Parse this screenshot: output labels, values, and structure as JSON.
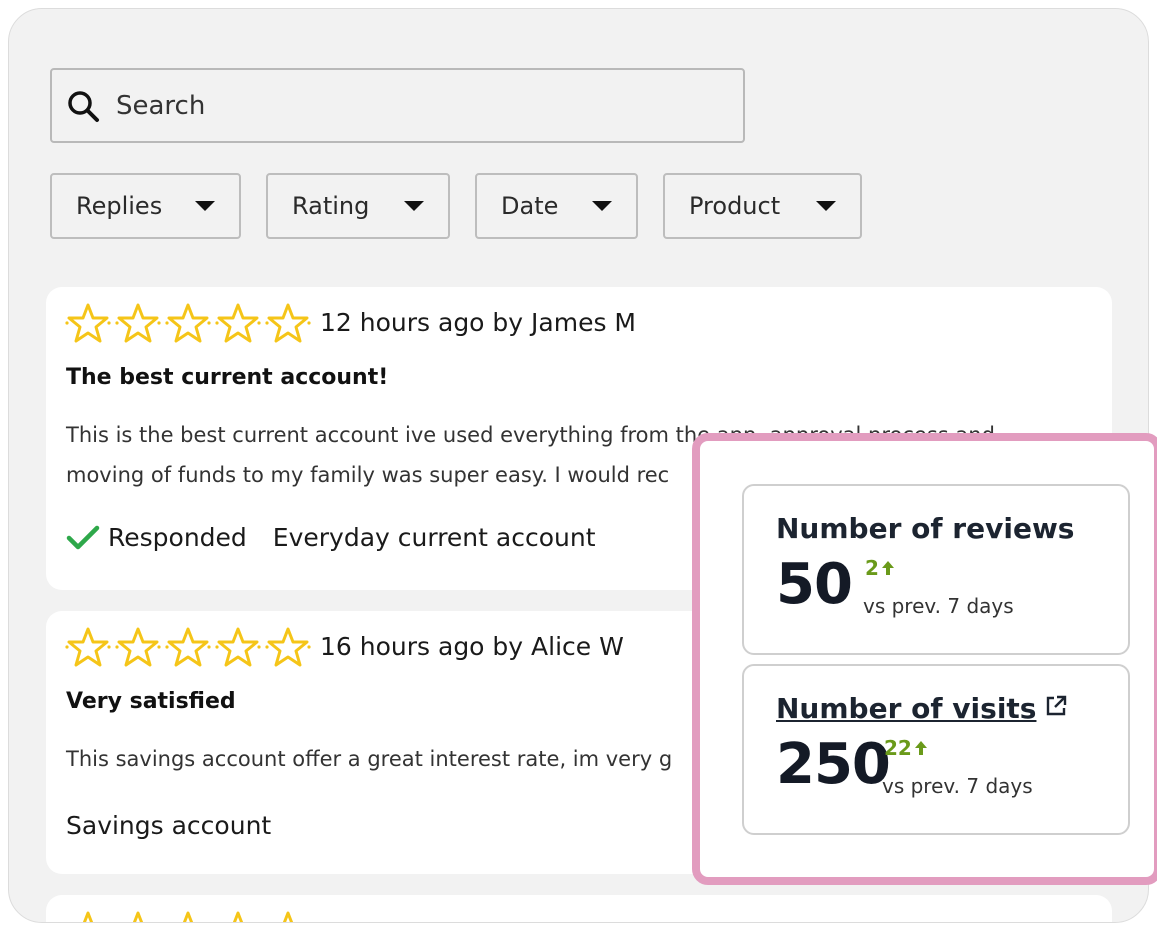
{
  "search": {
    "placeholder": "Search",
    "icon": "search-icon"
  },
  "filters": [
    {
      "label": "Replies"
    },
    {
      "label": "Rating"
    },
    {
      "label": "Date"
    },
    {
      "label": "Product"
    }
  ],
  "reviews": [
    {
      "rating": 5,
      "meta": "12 hours ago by James M",
      "title": "The best current account!",
      "body": "This is the best current account ive used everything from the app, approval process and moving of funds to my family was super easy. I would rec",
      "status": "Responded",
      "product": "Everyday current account"
    },
    {
      "rating": 5,
      "meta": "16 hours ago by Alice W",
      "title": "Very satisfied",
      "body": "This savings account offer a great interest rate, im very g",
      "product": "Savings account"
    }
  ],
  "stats": [
    {
      "label": "Number of reviews",
      "value": "50",
      "delta": "2",
      "subtitle": "vs prev. 7 days"
    },
    {
      "label": "Number of visits",
      "value": "250",
      "delta": "22",
      "subtitle": "vs prev. 7 days"
    }
  ],
  "colors": {
    "star": "#f5c518",
    "check": "#2ea84a",
    "delta": "#6a9a1a",
    "panel_border": "#e29cbf"
  }
}
